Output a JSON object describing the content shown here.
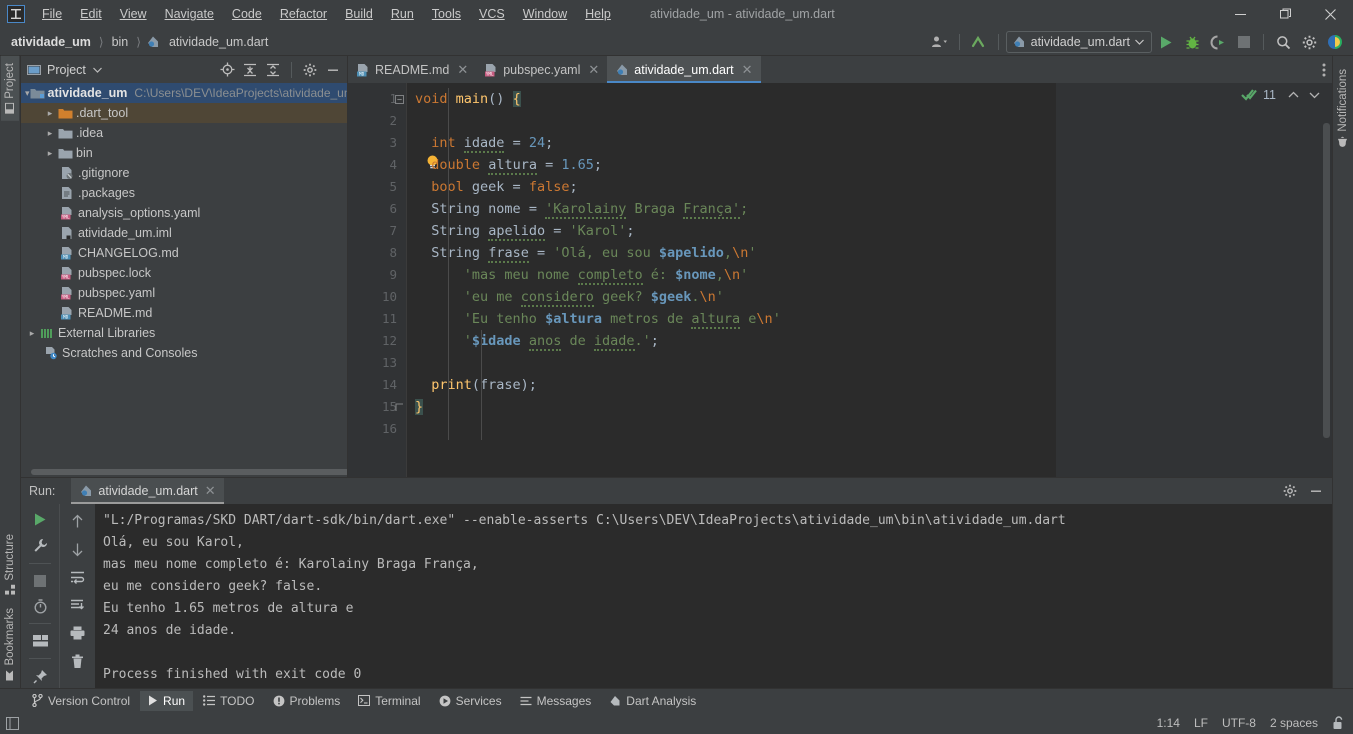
{
  "window": {
    "title": "atividade_um - atividade_um.dart",
    "logo_text": "IJ",
    "minimize": "minimize-icon",
    "maximize": "maximize-icon",
    "close": "close-icon"
  },
  "menu": [
    {
      "label": "File"
    },
    {
      "label": "Edit"
    },
    {
      "label": "View"
    },
    {
      "label": "Navigate"
    },
    {
      "label": "Code"
    },
    {
      "label": "Refactor"
    },
    {
      "label": "Build"
    },
    {
      "label": "Run"
    },
    {
      "label": "Tools"
    },
    {
      "label": "VCS"
    },
    {
      "label": "Window"
    },
    {
      "label": "Help"
    }
  ],
  "breadcrumbs": [
    {
      "label": "atividade_um",
      "bold": true
    },
    {
      "label": "bin",
      "bold": false
    },
    {
      "label": "atividade_um.dart",
      "bold": false
    }
  ],
  "toolbar": {
    "profile_label": "user-profile-icon",
    "updates_label": "update-arrow-icon",
    "run_config": "atividade_um.dart",
    "run_label": "run-icon",
    "debug_label": "debug-icon",
    "coverage_label": "run-with-coverage-icon",
    "stop_label": "stop-icon",
    "search_label": "search-everywhere-icon",
    "settings_label": "settings-icon",
    "dart_label": "dart-plugin-icon"
  },
  "project_panel": {
    "title": "Project",
    "header_icons": [
      "locate-icon",
      "expand-all-icon",
      "collapse-all-icon",
      "settings-icon",
      "hide-icon"
    ],
    "tree": [
      {
        "label": "atividade_um",
        "path": "C:\\Users\\DEV\\IdeaProjects\\atividade_um",
        "indent": 0,
        "twist": "v",
        "icon": "project-folder-icon",
        "bold": true,
        "state": "sel-blue"
      },
      {
        "label": ".dart_tool",
        "path": "",
        "indent": 1,
        "twist": ">",
        "icon": "excluded-folder-icon",
        "bold": false,
        "state": "sel-brown"
      },
      {
        "label": ".idea",
        "path": "",
        "indent": 1,
        "twist": ">",
        "icon": "folder-icon",
        "bold": false,
        "state": ""
      },
      {
        "label": "bin",
        "path": "",
        "indent": 1,
        "twist": ">",
        "icon": "folder-icon",
        "bold": false,
        "state": ""
      },
      {
        "label": ".gitignore",
        "path": "",
        "indent": 2,
        "twist": "",
        "icon": "gitignore-file-icon",
        "bold": false,
        "state": ""
      },
      {
        "label": ".packages",
        "path": "",
        "indent": 2,
        "twist": "",
        "icon": "text-file-icon",
        "bold": false,
        "state": ""
      },
      {
        "label": "analysis_options.yaml",
        "path": "",
        "indent": 2,
        "twist": "",
        "icon": "yaml-file-icon",
        "bold": false,
        "state": ""
      },
      {
        "label": "atividade_um.iml",
        "path": "",
        "indent": 2,
        "twist": "",
        "icon": "iml-file-icon",
        "bold": false,
        "state": ""
      },
      {
        "label": "CHANGELOG.md",
        "path": "",
        "indent": 2,
        "twist": "",
        "icon": "markdown-file-icon",
        "bold": false,
        "state": ""
      },
      {
        "label": "pubspec.lock",
        "path": "",
        "indent": 2,
        "twist": "",
        "icon": "yaml-file-icon",
        "bold": false,
        "state": ""
      },
      {
        "label": "pubspec.yaml",
        "path": "",
        "indent": 2,
        "twist": "",
        "icon": "yaml-file-icon",
        "bold": false,
        "state": ""
      },
      {
        "label": "README.md",
        "path": "",
        "indent": 2,
        "twist": "",
        "icon": "markdown-file-icon",
        "bold": false,
        "state": ""
      },
      {
        "label": "External Libraries",
        "path": "",
        "indent": 0,
        "twist": ">",
        "icon": "libraries-icon",
        "bold": false,
        "state": ""
      },
      {
        "label": "Scratches and Consoles",
        "path": "",
        "indent": 0,
        "twist": "",
        "icon": "scratches-icon",
        "bold": false,
        "state": ""
      }
    ]
  },
  "editor_tabs": [
    {
      "label": "README.md",
      "icon": "markdown-file-icon",
      "active": false
    },
    {
      "label": "pubspec.yaml",
      "icon": "yaml-file-icon",
      "active": false
    },
    {
      "label": "atividade_um.dart",
      "icon": "dart-file-icon",
      "active": true
    }
  ],
  "editor": {
    "line_numbers": [
      "1",
      "2",
      "3",
      "4",
      "5",
      "6",
      "7",
      "8",
      "9",
      "10",
      "11",
      "12",
      "13",
      "14",
      "15",
      "16"
    ],
    "inspection_count": "11",
    "inspection_icon": "inspection-ok-icon",
    "prev_icon": "chevron-up-icon",
    "next_icon": "chevron-down-icon",
    "intention_bulb": "lightbulb-icon",
    "code_lines": [
      "void main() {",
      "",
      "  int idade = 24;",
      "  double altura = 1.65;",
      "  bool geek = false;",
      "  String nome = 'Karolainy Braga França';",
      "  String apelido = 'Karol';",
      "  String frase = 'Olá, eu sou $apelido,\\n'",
      "      'mas meu nome completo é: $nome,\\n'",
      "      'eu me considero geek? $geek.\\n'",
      "      'Eu tenho $altura metros de altura e\\n'",
      "      '$idade anos de idade.';",
      "",
      "  print(frase);",
      "}",
      ""
    ]
  },
  "run_panel": {
    "label": "Run:",
    "tab_label": "atividade_um.dart",
    "tab_icon": "dart-file-icon",
    "settings_icon": "settings-icon",
    "hide_icon": "hide-icon",
    "tools": [
      "rerun-icon",
      "wrench-icon",
      "stop-icon",
      "timer-icon",
      "layout-icon",
      "pin-icon"
    ],
    "tools2": [
      "up-icon",
      "down-icon",
      "soft-wrap-icon",
      "scroll-to-end-icon",
      "print-icon",
      "clear-all-icon"
    ],
    "console_lines": [
      "\"L:/Programas/SKD DART/dart-sdk/bin/dart.exe\" --enable-asserts C:\\Users\\DEV\\IdeaProjects\\atividade_um\\bin\\atividade_um.dart",
      "Olá, eu sou Karol,",
      "mas meu nome completo é: Karolainy Braga França,",
      "eu me considero geek? false.",
      "Eu tenho 1.65 metros de altura e",
      "24 anos de idade.",
      "",
      "Process finished with exit code 0"
    ]
  },
  "left_rail": {
    "top": [
      {
        "label": "Project",
        "icon": "project-icon",
        "active": true
      }
    ],
    "bottom": [
      {
        "label": "Structure",
        "icon": "structure-icon",
        "active": false
      },
      {
        "label": "Bookmarks",
        "icon": "bookmarks-icon",
        "active": false
      }
    ]
  },
  "right_rail": {
    "items": [
      {
        "label": "Notifications",
        "icon": "bell-icon"
      }
    ]
  },
  "bottom_bar": [
    {
      "label": "Version Control",
      "icon": "branch-icon",
      "active": false
    },
    {
      "label": "Run",
      "icon": "run-icon",
      "active": true
    },
    {
      "label": "TODO",
      "icon": "todo-icon",
      "active": false
    },
    {
      "label": "Problems",
      "icon": "problems-icon",
      "active": false
    },
    {
      "label": "Terminal",
      "icon": "terminal-icon",
      "active": false
    },
    {
      "label": "Services",
      "icon": "services-icon",
      "active": false
    },
    {
      "label": "Messages",
      "icon": "messages-icon",
      "active": false
    },
    {
      "label": "Dart Analysis",
      "icon": "dart-icon",
      "active": false
    }
  ],
  "status_bar": {
    "left_icon": "layout-toggle-icon",
    "caret": "1:14",
    "line_sep": "LF",
    "encoding": "UTF-8",
    "indent": "2 spaces",
    "lock_icon": "unlocked-icon"
  },
  "colors": {
    "chrome": "#3c3f41",
    "editor_bg": "#2b2b2b",
    "gutter_bg": "#313335",
    "accent_blue": "#4a88c7",
    "selection_blue": "#2f4b70",
    "selection_brown": "#4f4636",
    "keyword": "#cc7832",
    "string": "#6a8759",
    "number": "#6897bb",
    "text": "#a9b7c6",
    "run_green": "#59a869"
  }
}
